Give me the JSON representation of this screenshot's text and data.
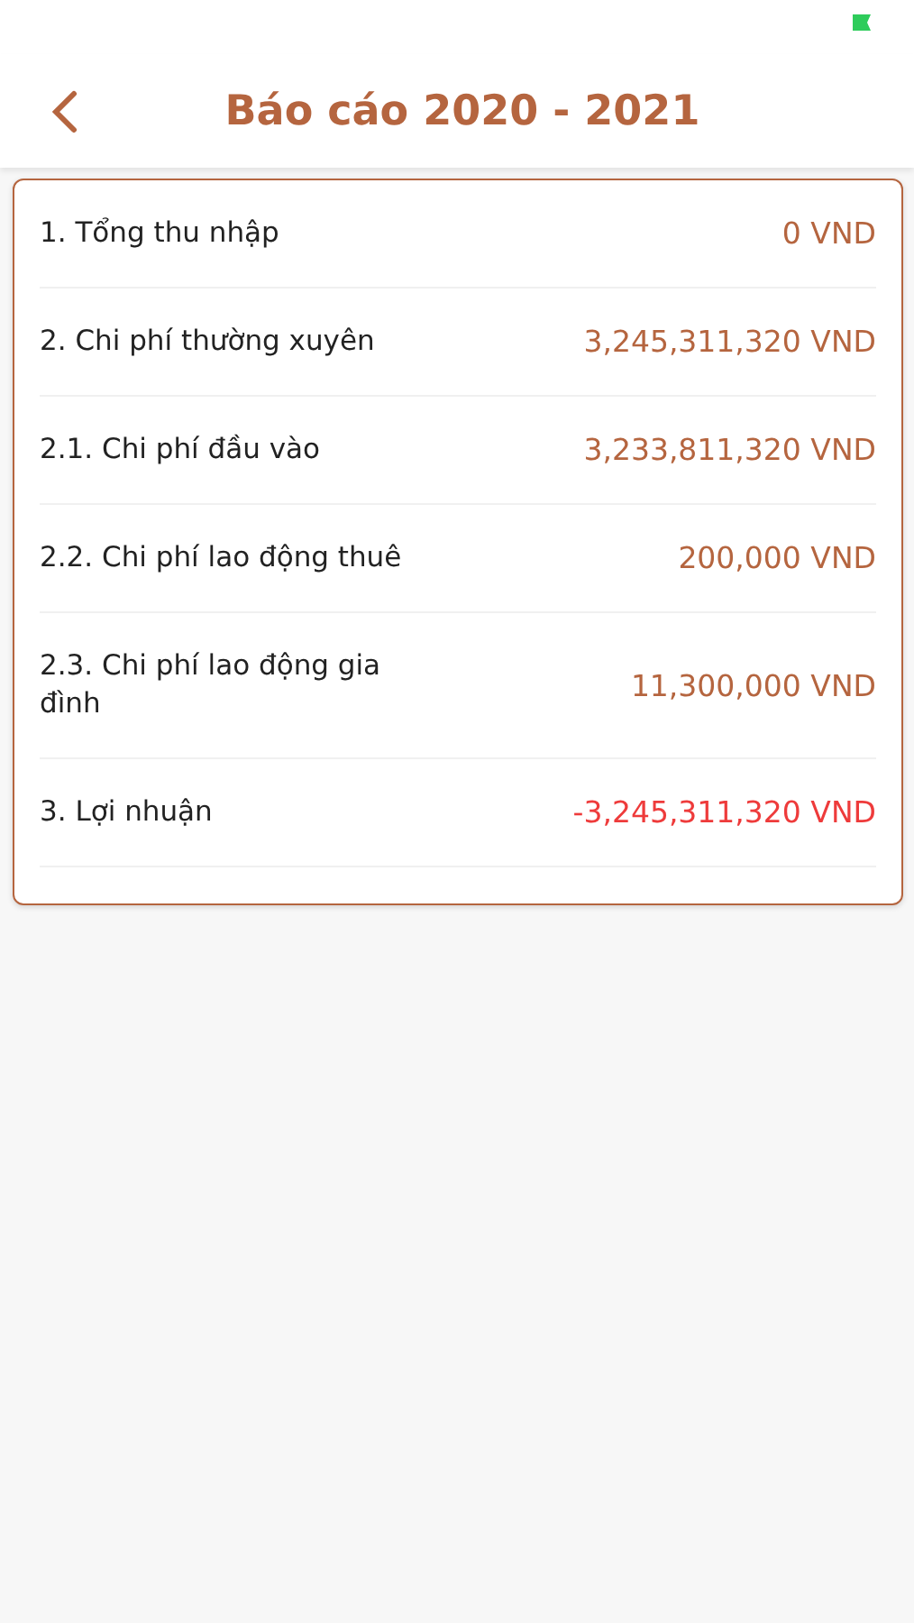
{
  "header": {
    "title": "Báo cáo 2020 - 2021"
  },
  "rows": [
    {
      "label": "1. Tổng thu nhập",
      "value": "0 VND",
      "color": "#b5653f"
    },
    {
      "label": "2. Chi phí thường xuyên",
      "value": "3,245,311,320 VND",
      "color": "#b5653f"
    },
    {
      "label": "2.1. Chi phí đầu vào",
      "value": "3,233,811,320 VND",
      "color": "#b5653f"
    },
    {
      "label": "2.2. Chi phí lao động thuê",
      "value": "200,000 VND",
      "color": "#b5653f"
    },
    {
      "label": "2.3. Chi phí lao động gia đình",
      "value": "11,300,000 VND",
      "color": "#b5653f"
    },
    {
      "label": "3. Lợi nhuận",
      "value": "-3,245,311,320 VND",
      "color": "#ee3b3b"
    }
  ]
}
